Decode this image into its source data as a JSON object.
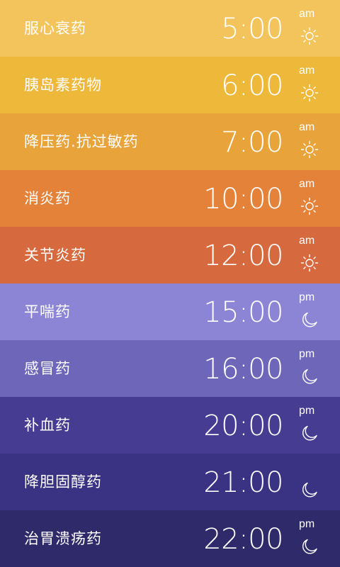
{
  "reminders": [
    {
      "name": "服心衰药",
      "time": "5:00",
      "period": "am",
      "icon": "sun-icon",
      "color": "#F4C45C"
    },
    {
      "name": "胰岛素药物",
      "time": "6:00",
      "period": "am",
      "icon": "sun-icon",
      "color": "#EEB83A"
    },
    {
      "name": "降压药.抗过敏药",
      "time": "7:00",
      "period": "am",
      "icon": "sun-icon",
      "color": "#E8A43A"
    },
    {
      "name": "消炎药",
      "time": "10:00",
      "period": "am",
      "icon": "sun-icon",
      "color": "#E4823A"
    },
    {
      "name": "关节炎药",
      "time": "12:00",
      "period": "am",
      "icon": "sun-icon",
      "color": "#D66A3E"
    },
    {
      "name": "平喘药",
      "time": "15:00",
      "period": "pm",
      "icon": "moon-icon",
      "color": "#8C85D6"
    },
    {
      "name": "感冒药",
      "time": "16:00",
      "period": "pm",
      "icon": "moon-icon",
      "color": "#6E66B8"
    },
    {
      "name": "补血药",
      "time": "20:00",
      "period": "pm",
      "icon": "moon-icon",
      "color": "#463C92"
    },
    {
      "name": "降胆固醇药",
      "time": "21:00",
      "period": "",
      "icon": "moon-icon",
      "color": "#3A3282"
    },
    {
      "name": "治胃溃疡药",
      "time": "22:00",
      "period": "pm",
      "icon": "moon-icon",
      "color": "#2F2A6A"
    }
  ]
}
